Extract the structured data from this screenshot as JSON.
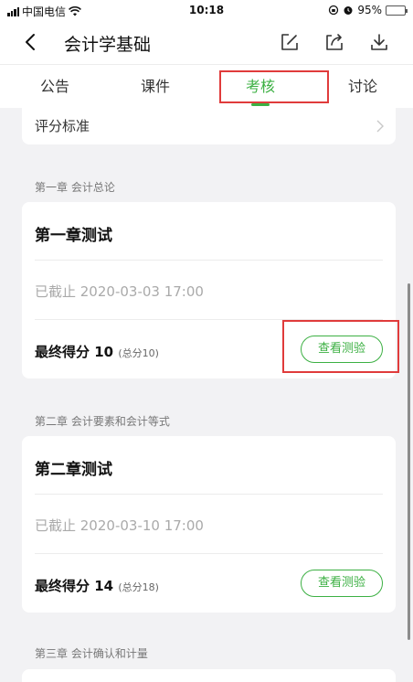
{
  "status_bar": {
    "carrier": "中国电信",
    "time": "10:18",
    "battery": "95%",
    "battery_level": 0.95
  },
  "header": {
    "title": "会计学基础",
    "icons": [
      "back-icon",
      "edit-icon",
      "share-icon",
      "download-icon"
    ]
  },
  "tabs": [
    {
      "label": "公告"
    },
    {
      "label": "课件"
    },
    {
      "label": "考核",
      "active": true
    },
    {
      "label": "讨论"
    }
  ],
  "criteria": {
    "label": "评分标准"
  },
  "chapters": [
    {
      "section": "第一章 会计总论",
      "quiz_title": "第一章测试",
      "deadline": "已截止 2020-03-03 17:00",
      "score_label": "最终得分 10",
      "score_total": "(总分10)",
      "button": "查看测验"
    },
    {
      "section": "第二章 会计要素和会计等式",
      "quiz_title": "第二章测试",
      "deadline": "已截止 2020-03-10 17:00",
      "score_label": "最终得分 14",
      "score_total": "(总分18)",
      "button": "查看测验"
    },
    {
      "section": "第三章 会计确认和计量"
    }
  ],
  "colors": {
    "accent": "#3cb043",
    "highlight": "#e03b3b",
    "background": "#f2f2f4"
  }
}
